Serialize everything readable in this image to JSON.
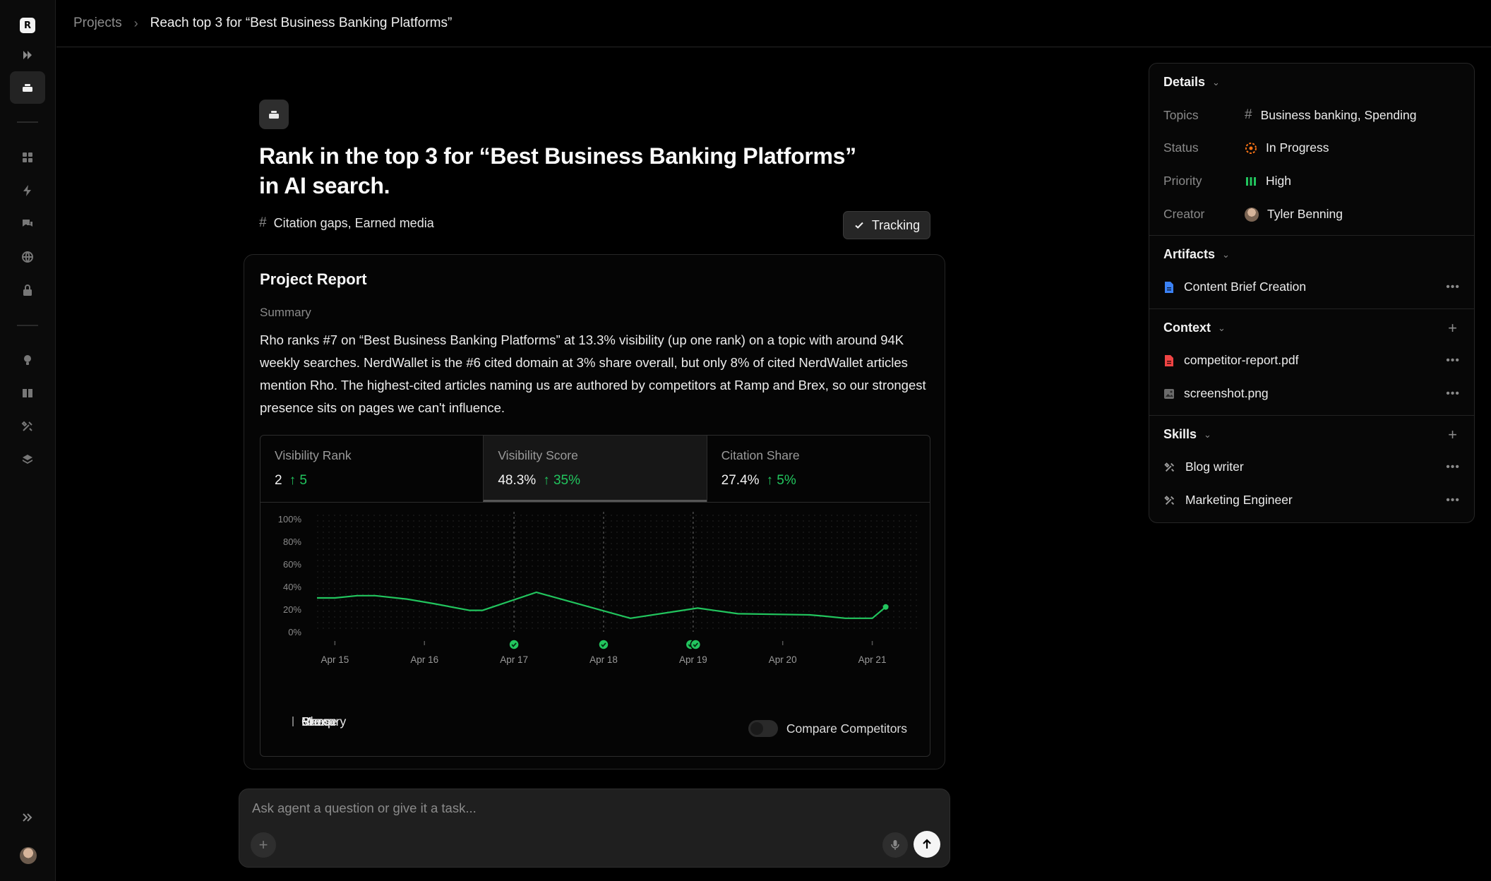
{
  "app": {
    "logo_letter": "R"
  },
  "rail": {
    "icons": [
      "collapse-icon",
      "projects-icon",
      "dashboard-icon",
      "lightning-icon",
      "chat-icon",
      "globe-icon",
      "lock-icon",
      "lightbulb-icon",
      "book-icon",
      "tools-icon",
      "layers-icon",
      "expand-icon"
    ]
  },
  "breadcrumb": {
    "root": "Projects",
    "separator": "›",
    "current": "Reach top 3 for “Best Business Banking Platforms”"
  },
  "project": {
    "title_line1": "Rank in the top 3 for “Best Business Banking Platforms”",
    "title_line2": "in AI search.",
    "tags_hash": "#",
    "tags": "Citation gaps, Earned media",
    "tracking_label": "Tracking"
  },
  "report": {
    "title": "Project Report",
    "summary_label": "Summary",
    "summary": "Rho ranks #7 on “Best Business Banking Platforms” at 13.3% visibility (up one rank) on a topic with around 94K weekly searches. NerdWallet is the #6 cited domain at 3% share overall, but only 8% of cited NerdWallet articles mention Rho. The highest-cited articles naming us are authored by competitors at Ramp and Brex, so our strongest presence sits on pages we can't influence.",
    "metrics": [
      {
        "label": "Visibility Rank",
        "value": "2",
        "delta": "↑ 5"
      },
      {
        "label": "Visibility Score",
        "value": "48.3%",
        "delta": "↑ 35%"
      },
      {
        "label": "Citation Share",
        "value": "27.4%",
        "delta": "↑ 5%"
      }
    ],
    "legend": [
      "Ramp",
      "Brex",
      "Chase",
      "Mercury"
    ],
    "compare_label": "Compare Competitors"
  },
  "chart_data": {
    "type": "line",
    "y_ticks": [
      "100%",
      "80%",
      "60%",
      "40%",
      "20%",
      "0%"
    ],
    "ylim": [
      0,
      100
    ],
    "x_ticks": [
      "Apr 15",
      "Apr 16",
      "Apr 17",
      "Apr 18",
      "Apr 19",
      "Apr 20",
      "Apr 21"
    ],
    "xlim": [
      14.8,
      21.5
    ],
    "line_color": "#22c55e",
    "series": [
      {
        "x": [
          14.8,
          15.0,
          15.25,
          15.45,
          15.8,
          16.1,
          16.5,
          16.65,
          17.25,
          18.3,
          19.05,
          19.5,
          20.3,
          20.45,
          20.7,
          21.0,
          21.15
        ],
        "values": [
          30,
          30,
          32,
          32,
          29,
          25,
          19,
          19,
          35,
          12,
          21,
          16,
          15,
          14,
          12,
          12,
          22
        ]
      }
    ],
    "event_markers": [
      "Apr 17",
      "Apr 18",
      "Apr 19",
      "Apr 19"
    ]
  },
  "composer": {
    "placeholder": "Ask agent a question or give it a task..."
  },
  "details": {
    "title": "Details",
    "rows": [
      {
        "key": "Topics",
        "value": "Business banking, Spending",
        "icon": "hash-icon"
      },
      {
        "key": "Status",
        "value": "In Progress",
        "icon": "in-progress-icon",
        "color": "#f97316"
      },
      {
        "key": "Priority",
        "value": "High",
        "icon": "priority-high-icon",
        "color": "#22c55e"
      },
      {
        "key": "Creator",
        "value": "Tyler Benning",
        "icon": "avatar"
      }
    ]
  },
  "artifacts": {
    "title": "Artifacts",
    "items": [
      {
        "label": "Content Brief Creation",
        "icon": "document-icon",
        "color": "#3b82f6"
      }
    ]
  },
  "context": {
    "title": "Context",
    "items": [
      {
        "label": "competitor-report.pdf",
        "icon": "pdf-icon",
        "color": "#ef4444"
      },
      {
        "label": "screenshot.png",
        "icon": "image-icon"
      }
    ]
  },
  "skills": {
    "title": "Skills",
    "items": [
      {
        "label": "Blog writer",
        "icon": "tools-icon"
      },
      {
        "label": "Marketing Engineer",
        "icon": "tools-icon"
      }
    ]
  }
}
